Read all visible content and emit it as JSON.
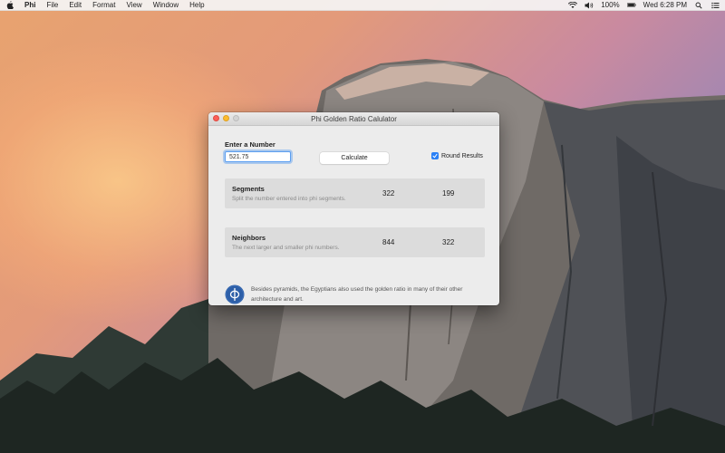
{
  "menubar": {
    "apple_icon": "apple-icon",
    "app_name": "Phi",
    "menus": [
      "File",
      "Edit",
      "Format",
      "View",
      "Window",
      "Help"
    ],
    "battery": "100%",
    "clock": "Wed 6:28 PM"
  },
  "window": {
    "title": "Phi Golden Ratio Calulator"
  },
  "input": {
    "label": "Enter a Number",
    "value": "521.75"
  },
  "buttons": {
    "calculate": "Calculate"
  },
  "options": {
    "round_results": "Round Results",
    "round_checked": true
  },
  "segments": {
    "title": "Segments",
    "subtitle": "Split the number entered into phi segments.",
    "value1": "322",
    "value2": "199"
  },
  "neighbors": {
    "title": "Neighbors",
    "subtitle": "The next larger and smaller phi numbers.",
    "value1": "844",
    "value2": "322"
  },
  "footer": {
    "icon": "phi-icon",
    "fact": "Besides pyramids, the Egyptians also used the golden ratio in many of their other architecture and art."
  },
  "colors": {
    "accent": "#2a80f6",
    "phi_icon": "#2d5fa8",
    "close": "#fc5f57",
    "minimize": "#fdbc2e"
  }
}
